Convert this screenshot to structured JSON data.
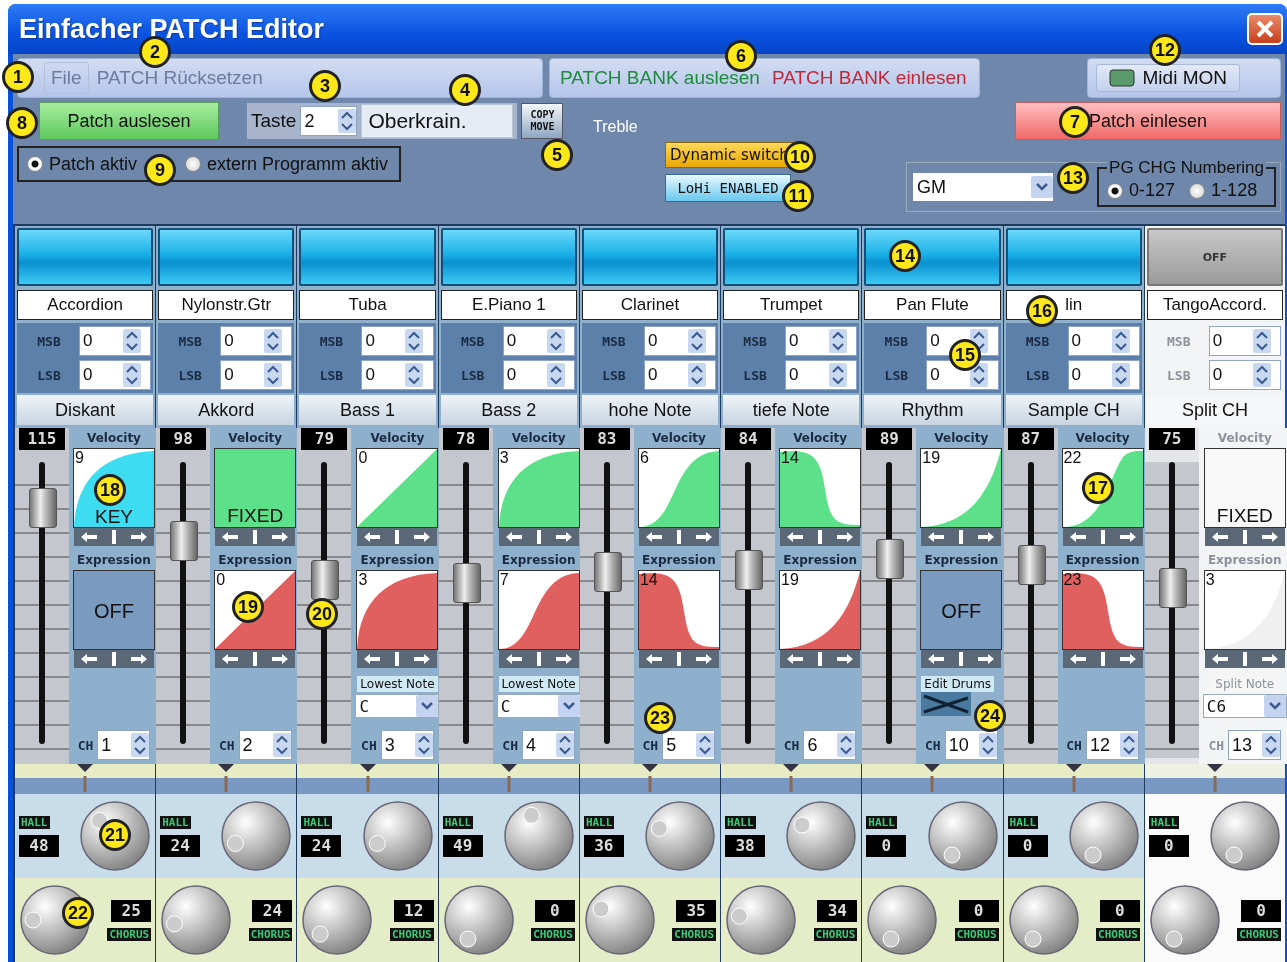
{
  "window": {
    "title": "Einfacher PATCH Editor"
  },
  "menu": {
    "file": {
      "label": "File",
      "disabled": true
    },
    "reset": {
      "label": "PATCH Rücksetzen",
      "disabled": true
    },
    "bank_read": {
      "label": "PATCH BANK auslesen"
    },
    "bank_write": {
      "label": "PATCH BANK einlesen"
    },
    "midi_mon": {
      "label": "Midi MON"
    }
  },
  "patch": {
    "read_button": "Patch auslesen",
    "key_label": "Taste",
    "key_value": "2",
    "name_value": "Oberkrain.",
    "copy_move": "COPY MOVE",
    "write_button": "Patch einlesen"
  },
  "mode": [
    {
      "label": "Patch aktiv",
      "selected": true
    },
    {
      "label": "extern Programm aktiv",
      "selected": false
    }
  ],
  "routing": {
    "treble": "Treble",
    "dynamic_switch": "Dynamic switch",
    "lohi": "LoHi ENABLED"
  },
  "sound_set": {
    "value": "GM"
  },
  "pg_numbering": {
    "title": "PG CHG Numbering",
    "options": [
      {
        "label": "0-127",
        "selected": true
      },
      {
        "label": "1-128",
        "selected": false
      }
    ]
  },
  "strips": [
    {
      "on": true,
      "disabled": false,
      "instrument": "Accordion",
      "msb_label": "MSB",
      "msb": "0",
      "lsb_label": "LSB",
      "lsb": "0",
      "function": "Diskant",
      "volume": "115",
      "level": 0.9,
      "velocity_label": "Velocity",
      "velocity": {
        "kind": "key",
        "value": "9",
        "label": "KEY"
      },
      "expression_label": "Expression",
      "expression": {
        "kind": "off",
        "label": "OFF"
      },
      "ch_label": "CH",
      "ch": "1",
      "hall_label": "HALL",
      "hall": {
        "value": "48"
      },
      "chorus_label": "CHORUS",
      "chorus": {
        "value": "25"
      }
    },
    {
      "on": true,
      "disabled": false,
      "instrument": "Nylonstr.Gtr",
      "msb_label": "MSB",
      "msb": "0",
      "lsb_label": "LSB",
      "lsb": "0",
      "function": "Akkord",
      "volume": "98",
      "level": 0.77,
      "velocity_label": "Velocity",
      "velocity": {
        "kind": "fixed",
        "label": "FIXED"
      },
      "expression_label": "Expression",
      "expression": {
        "kind": "curve",
        "value": "0"
      },
      "ch_label": "CH",
      "ch": "2",
      "hall_label": "HALL",
      "hall": {
        "value": "24"
      },
      "chorus_label": "CHORUS",
      "chorus": {
        "value": "24"
      }
    },
    {
      "on": true,
      "disabled": false,
      "instrument": "Tuba",
      "msb_label": "MSB",
      "msb": "0",
      "lsb_label": "LSB",
      "lsb": "0",
      "function": "Bass 1",
      "volume": "79",
      "level": 0.62,
      "velocity_label": "Velocity",
      "velocity": {
        "kind": "curve",
        "value": "0"
      },
      "expression_label": "Expression",
      "expression": {
        "kind": "curve",
        "value": "3"
      },
      "extra": {
        "kind": "lowest_note",
        "label": "Lowest Note",
        "value": "C"
      },
      "ch_label": "CH",
      "ch": "3",
      "hall_label": "HALL",
      "hall": {
        "value": "24"
      },
      "chorus_label": "CHORUS",
      "chorus": {
        "value": "12"
      }
    },
    {
      "on": true,
      "disabled": false,
      "instrument": "E.Piano 1",
      "msb_label": "MSB",
      "msb": "0",
      "lsb_label": "LSB",
      "lsb": "0",
      "function": "Bass 2",
      "volume": "78",
      "level": 0.61,
      "velocity_label": "Velocity",
      "velocity": {
        "kind": "curve",
        "value": "3"
      },
      "expression_label": "Expression",
      "expression": {
        "kind": "curve",
        "value": "7"
      },
      "extra": {
        "kind": "lowest_note",
        "label": "Lowest Note",
        "value": "C"
      },
      "ch_label": "CH",
      "ch": "4",
      "hall_label": "HALL",
      "hall": {
        "value": "49"
      },
      "chorus_label": "CHORUS",
      "chorus": {
        "value": "0"
      }
    },
    {
      "on": true,
      "disabled": false,
      "instrument": "Clarinet",
      "msb_label": "MSB",
      "msb": "0",
      "lsb_label": "LSB",
      "lsb": "0",
      "function": "hohe Note",
      "volume": "83",
      "level": 0.65,
      "velocity_label": "Velocity",
      "velocity": {
        "kind": "curve",
        "value": "6"
      },
      "expression_label": "Expression",
      "expression": {
        "kind": "curve",
        "value": "14"
      },
      "ch_label": "CH",
      "ch": "5",
      "hall_label": "HALL",
      "hall": {
        "value": "36"
      },
      "chorus_label": "CHORUS",
      "chorus": {
        "value": "35"
      }
    },
    {
      "on": true,
      "disabled": false,
      "instrument": "Trumpet",
      "msb_label": "MSB",
      "msb": "0",
      "lsb_label": "LSB",
      "lsb": "0",
      "function": "tiefe Note",
      "volume": "84",
      "level": 0.66,
      "velocity_label": "Velocity",
      "velocity": {
        "kind": "curve",
        "value": "14"
      },
      "expression_label": "Expression",
      "expression": {
        "kind": "curve",
        "value": "19"
      },
      "ch_label": "CH",
      "ch": "6",
      "hall_label": "HALL",
      "hall": {
        "value": "38"
      },
      "chorus_label": "CHORUS",
      "chorus": {
        "value": "34"
      }
    },
    {
      "on": true,
      "disabled": false,
      "instrument": "Pan Flute",
      "msb_label": "MSB",
      "msb": "0",
      "lsb_label": "LSB",
      "lsb": "0",
      "function": "Rhythm",
      "volume": "89",
      "level": 0.7,
      "velocity_label": "Velocity",
      "velocity": {
        "kind": "curve",
        "value": "19"
      },
      "expression_label": "Expression",
      "expression": {
        "kind": "off",
        "label": "OFF"
      },
      "extra": {
        "kind": "edit_drums",
        "label": "Edit Drums"
      },
      "ch_label": "CH",
      "ch": "10",
      "hall_label": "HALL",
      "hall": {
        "value": "0"
      },
      "chorus_label": "CHORUS",
      "chorus": {
        "value": "0"
      }
    },
    {
      "on": true,
      "disabled": false,
      "instrument": "lin",
      "msb_label": "MSB",
      "msb": "0",
      "lsb_label": "LSB",
      "lsb": "0",
      "function": "Sample CH",
      "volume": "87",
      "level": 0.68,
      "velocity_label": "Velocity",
      "velocity": {
        "kind": "curve",
        "value": "22"
      },
      "expression_label": "Expression",
      "expression": {
        "kind": "curve",
        "value": "23"
      },
      "ch_label": "CH",
      "ch": "12",
      "hall_label": "HALL",
      "hall": {
        "value": "0"
      },
      "chorus_label": "CHORUS",
      "chorus": {
        "value": "0"
      }
    },
    {
      "on": false,
      "off_label": "OFF",
      "disabled": true,
      "instrument": "TangoAccord.",
      "msb_label": "MSB",
      "msb": "0",
      "lsb_label": "LSB",
      "lsb": "0",
      "function": "Split CH",
      "volume": "75",
      "level": 0.59,
      "velocity_label": "Velocity",
      "velocity": {
        "kind": "fixed",
        "label": "FIXED"
      },
      "expression_label": "Expression",
      "expression": {
        "kind": "curve",
        "value": "3"
      },
      "extra": {
        "kind": "split_note",
        "label": "Split Note",
        "value": "C6"
      },
      "ch_label": "CH",
      "ch": "13",
      "hall_label": "HALL",
      "hall": {
        "value": "0"
      },
      "chorus_label": "CHORUS",
      "chorus": {
        "value": "0"
      }
    }
  ],
  "callouts": [
    {
      "label": "1"
    },
    {
      "label": "2"
    },
    {
      "label": "3"
    },
    {
      "label": "4"
    },
    {
      "label": "5"
    },
    {
      "label": "6"
    },
    {
      "label": "7"
    },
    {
      "label": "8"
    },
    {
      "label": "9"
    },
    {
      "label": "10"
    },
    {
      "label": "11"
    },
    {
      "label": "12"
    },
    {
      "label": "13"
    },
    {
      "label": "14"
    },
    {
      "label": "15"
    },
    {
      "label": "16"
    },
    {
      "label": "17"
    },
    {
      "label": "18"
    },
    {
      "label": "19"
    },
    {
      "label": "20"
    },
    {
      "label": "21"
    },
    {
      "label": "22"
    },
    {
      "label": "23"
    },
    {
      "label": "24"
    }
  ]
}
